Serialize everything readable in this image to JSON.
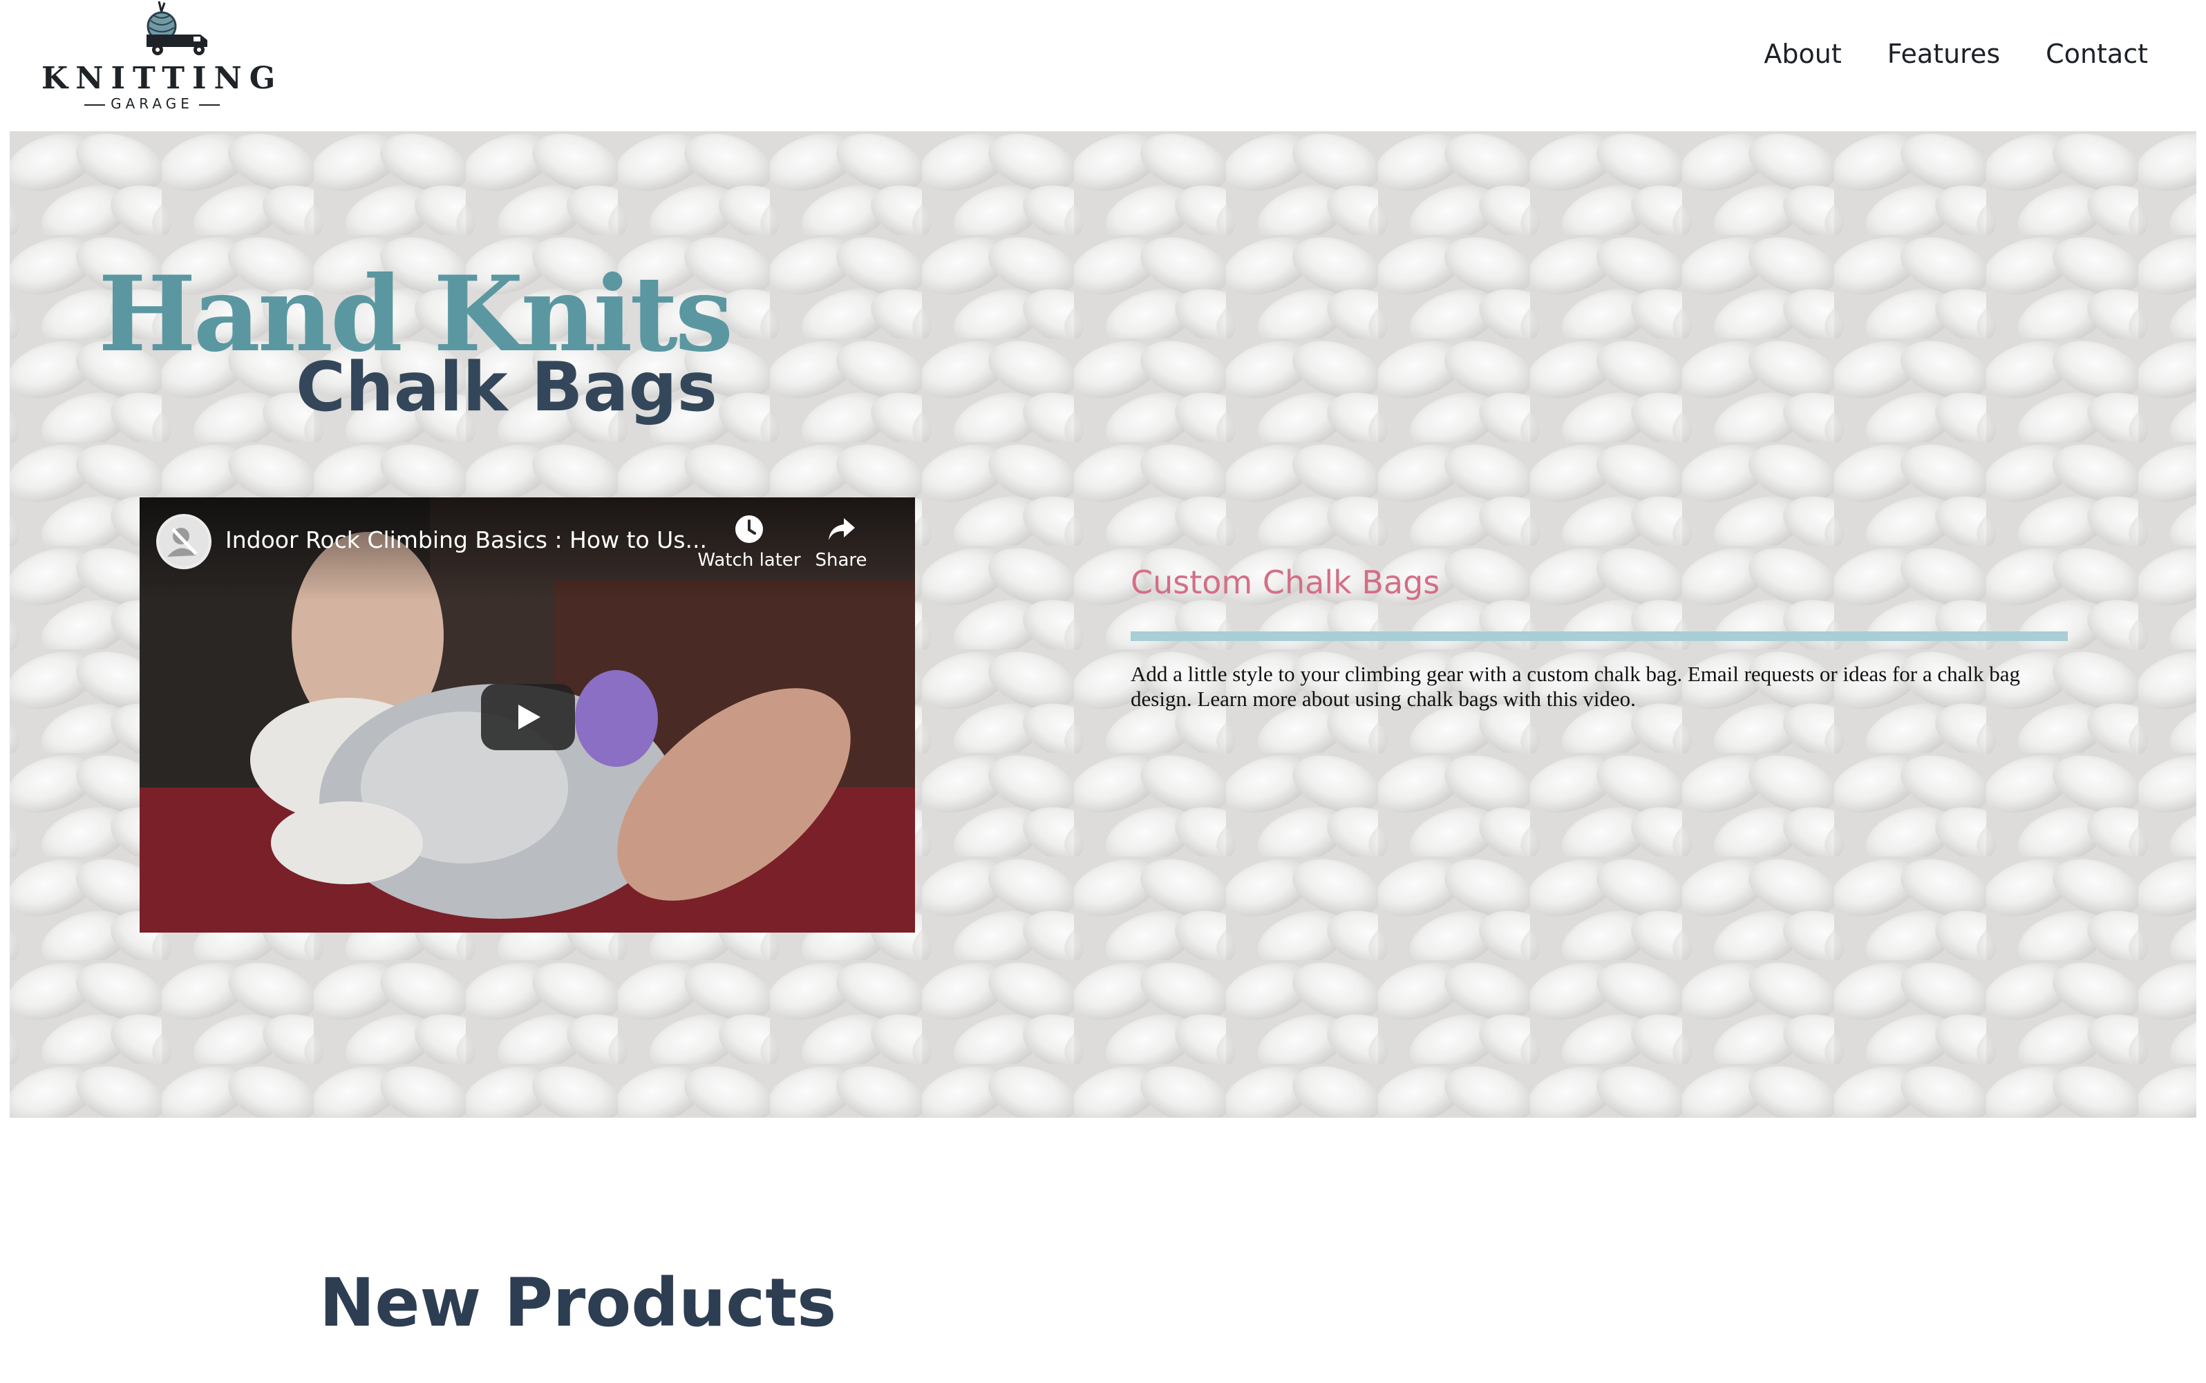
{
  "header": {
    "logo": {
      "word": "KNITTING",
      "sub": "GARAGE"
    },
    "nav": [
      {
        "label": "About"
      },
      {
        "label": "Features"
      },
      {
        "label": "Contact"
      }
    ]
  },
  "hero": {
    "title_main": "Hand Knits",
    "title_sub": "Chalk Bags",
    "video": {
      "title": "Indoor Rock Climbing Basics : How to Us...",
      "watch_later_label": "Watch later",
      "share_label": "Share"
    },
    "copy": {
      "heading": "Custom Chalk Bags",
      "body": "Add a little style to your climbing gear with a custom chalk bag. Email requests or ideas for a chalk bag design. Learn more about using chalk bags with this video."
    }
  },
  "sections": {
    "new_products_title": "New Products"
  },
  "colors": {
    "title_teal": "#5b97a1",
    "title_navy": "#34475a",
    "heading_pink": "#d46e84",
    "rule_blue": "#a7cfd5"
  }
}
